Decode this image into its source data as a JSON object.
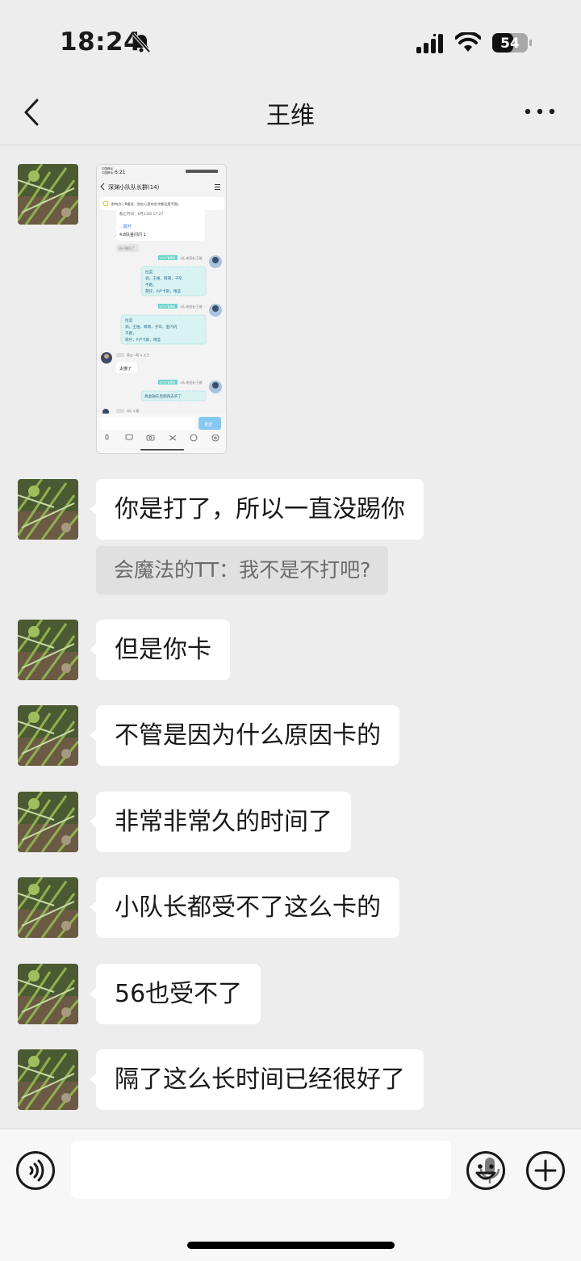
{
  "status_bar": {
    "time": "18:24",
    "battery": "54"
  },
  "nav": {
    "title": "王维"
  },
  "screenshot": {
    "status_left_1": "中国移动",
    "status_left_2": "中国移动",
    "status_time": "6:21",
    "group_title": "深渊小队队长群(14)",
    "notice": "群待办 | 8楼龙、别在心里的名字都还是不跑。",
    "msg_partial": "截止时间：6月23日 17:27",
    "expand": "...展开",
    "msg_line": "4.8队金闪闪 1",
    "recall": "萌仔撤回了",
    "sender_name": "1队·老班长·王维",
    "sender_badge": "LV10 管理员",
    "reply_1": "拉蓝\n调，王维，萌萌，子卒\n不跑，\n萌仔，P卢卡斯，晴蓝",
    "reply_2": "拉蓝\n调，王维，萌萌，子卒，金闪闪\n不跑，\n萌仔，P卢卡斯，晴蓝",
    "other_name": "萌五一萌 & 五兰",
    "other_msg": "太慢了",
    "reply_3": "真金融在后期再去买了",
    "last_sender": "4队·斗猫",
    "send_btn": "发送"
  },
  "messages": [
    {
      "text": "你是打了，所以一直没踢你",
      "quote": "会魔法的TT：我不是不打吧?"
    },
    {
      "text": "但是你卡"
    },
    {
      "text": "不管是因为什么原因卡的"
    },
    {
      "text": "非常非常久的时间了"
    },
    {
      "text": "小队长都受不了这么卡的"
    },
    {
      "text": "56也受不了"
    },
    {
      "text": "隔了这么长时间已经很好了"
    }
  ],
  "icons": {
    "back": "chevron-left-icon",
    "more": "more-dots-icon",
    "voice": "voice-icon",
    "mic": "microphone-icon",
    "emoji": "emoji-icon",
    "add": "plus-icon"
  }
}
